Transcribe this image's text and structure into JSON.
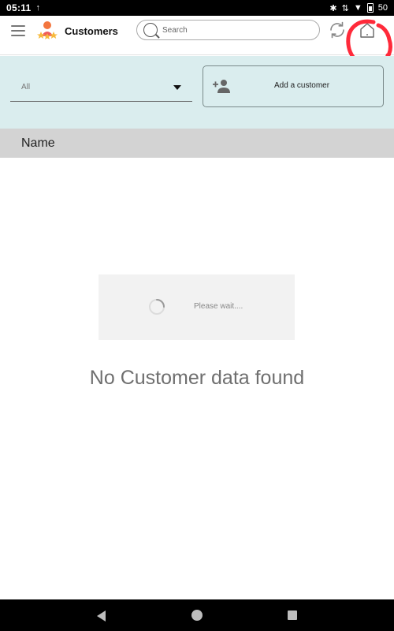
{
  "status_bar": {
    "time": "05:11",
    "upload": "↑",
    "battery_text": "50"
  },
  "app_bar": {
    "title": "Customers",
    "search": {
      "placeholder": "Search",
      "value": ""
    },
    "icons": [
      "menu-icon",
      "customers-logo-icon",
      "search-icon",
      "refresh-icon",
      "home-icon"
    ]
  },
  "filter": {
    "selected": "All",
    "add_button_label": "Add a customer"
  },
  "table": {
    "columns": [
      "Name"
    ],
    "rows": []
  },
  "loader": {
    "message": "Please wait...."
  },
  "empty_state": {
    "message": "No Customer data found"
  },
  "colors": {
    "panel": "#daedee",
    "header": "#d3d3d3",
    "annotation": "#ff2a3a"
  }
}
